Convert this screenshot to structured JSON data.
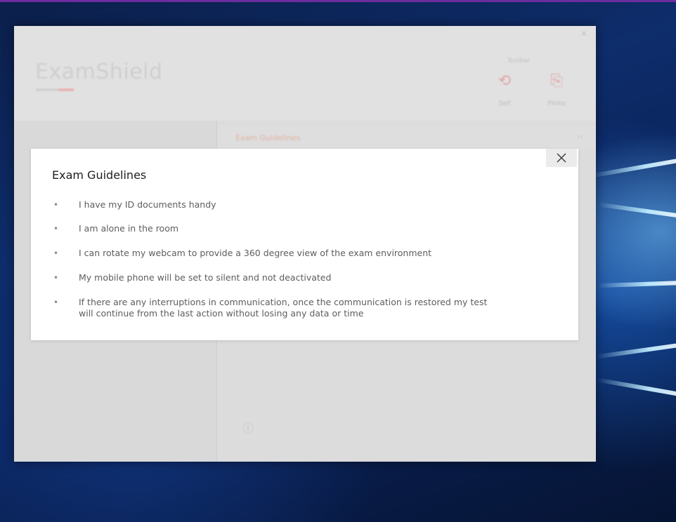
{
  "app": {
    "logo_text": "ExamShield",
    "toolbar_label": "Toolbar",
    "tools": [
      {
        "icon": "camera-icon",
        "label": "Self"
      },
      {
        "icon": "id-card-icon",
        "label": "Photo"
      }
    ],
    "section_title": "Exam Guidelines",
    "close_icon": "close-icon"
  },
  "modal": {
    "title": "Exam Guidelines",
    "close_icon": "close-icon",
    "guidelines": [
      "I have my ID documents handy",
      "I am alone in the room",
      "I can rotate my webcam to provide a 360 degree view of the exam environment",
      "My mobile phone will be set to silent and not deactivated",
      "If there are any interruptions in communication, once the communication is restored my test\nwill continue from the last action without losing any data or time"
    ]
  },
  "colors": {
    "modal_background": "#ffffff",
    "overlay": "#dcdcdc",
    "title_text": "#1e1e1e",
    "body_text": "#5d5d5d",
    "close_button_bg": "#ebebeb",
    "taskbar_accent": "#6d2d9e"
  }
}
